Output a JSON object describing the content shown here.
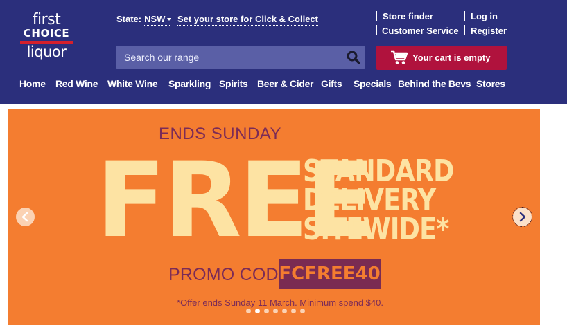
{
  "logo": {
    "line1": "first",
    "line2": "CHOICE",
    "line3": "liquor"
  },
  "header": {
    "state_label": "State:",
    "state_value": "NSW",
    "store_click_collect": "Set your store for Click & Collect",
    "store_finder": "Store finder",
    "customer_service": "Customer Service",
    "log_in": "Log in",
    "register": "Register"
  },
  "search": {
    "placeholder": "Search our range",
    "icon": "search-icon"
  },
  "cart": {
    "label": "Your cart is empty",
    "icon": "cart-icon",
    "color": "#b0123d"
  },
  "nav": {
    "items": [
      "Home",
      "Red Wine",
      "White Wine",
      "Sparkling",
      "Spirits",
      "Beer & Cider",
      "Gifts",
      "Specials",
      "Behind the Bevs",
      "Stores"
    ]
  },
  "banner": {
    "ends": "ENDS SUNDAY",
    "free": "FREE",
    "line1": "STANDARD",
    "line2": "DELIVERY",
    "line3": "SITEWIDE*",
    "promo_label": "PROMO CODE:",
    "promo_code": "FCFREE40",
    "offer": "*Offer ends Sunday 11 March. Minimum spend $40.",
    "slide_count": 7,
    "active_slide": 2,
    "background": "#f47d30",
    "accent": "#7b2b57",
    "cream": "#fde3a3"
  },
  "colors": {
    "header_bg": "#2b2f7c",
    "search_bg": "#5a5fa6"
  }
}
